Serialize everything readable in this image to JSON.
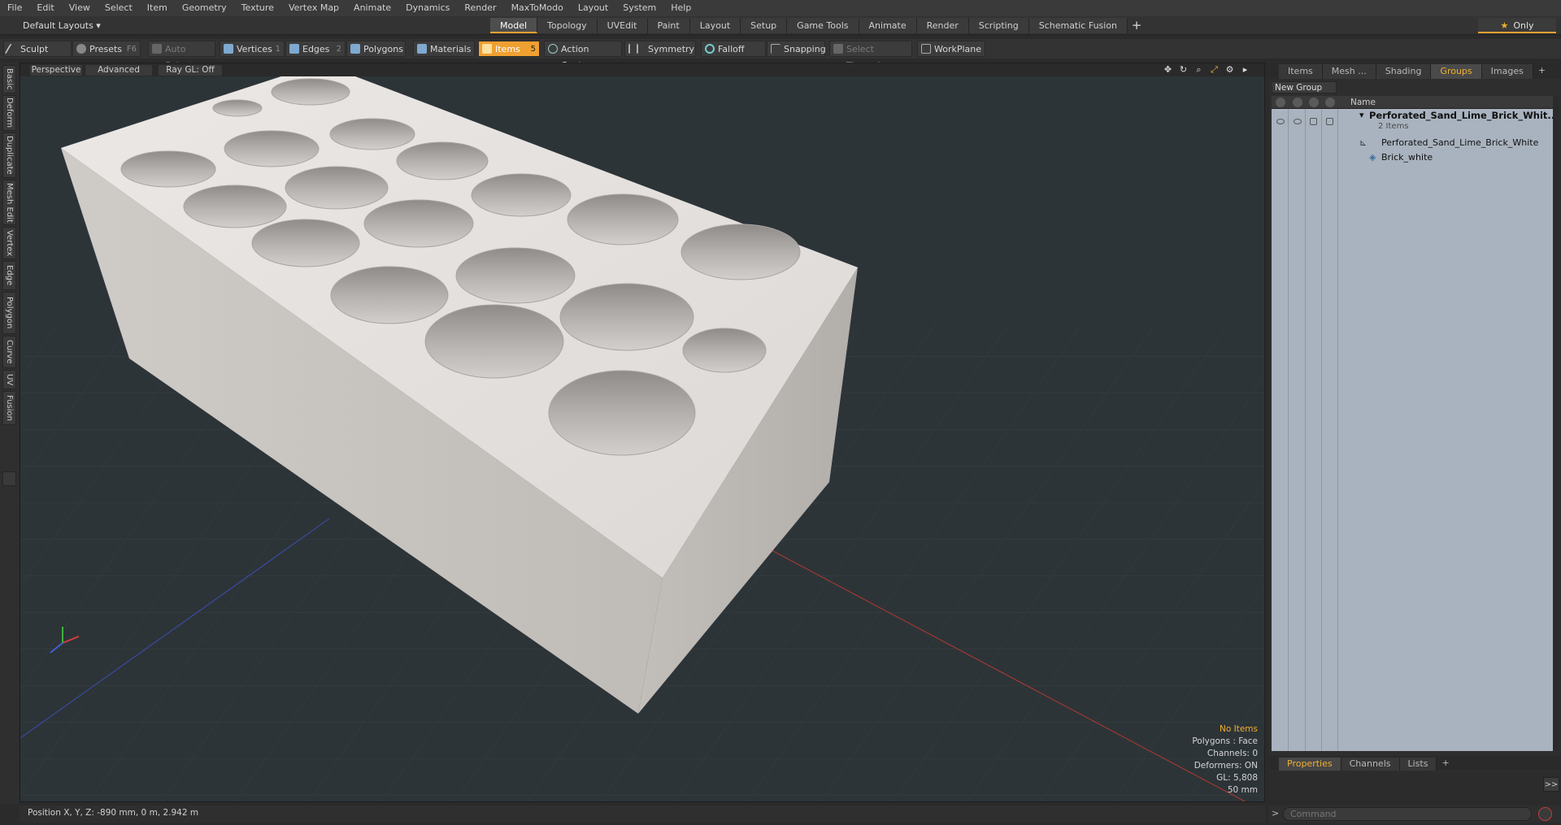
{
  "menu": [
    "File",
    "Edit",
    "View",
    "Select",
    "Item",
    "Geometry",
    "Texture",
    "Vertex Map",
    "Animate",
    "Dynamics",
    "Render",
    "MaxToModo",
    "Layout",
    "System",
    "Help"
  ],
  "layout_selector": "Default Layouts ▾",
  "layout_tabs": [
    "Model",
    "Topology",
    "UVEdit",
    "Paint",
    "Layout",
    "Setup",
    "Game Tools",
    "Animate",
    "Render",
    "Scripting",
    "Schematic Fusion"
  ],
  "layout_tab_plus": "+",
  "only_label": "Only",
  "toolbar": {
    "sculpt": "Sculpt",
    "presets": "Presets",
    "presets_key": "F6",
    "auto_select": "Auto Select",
    "vertices": "Vertices",
    "vertices_key": "1",
    "edges": "Edges",
    "edges_key": "2",
    "polygons": "Polygons",
    "materials": "Materials",
    "items": "Items",
    "items_key": "5",
    "action_center": "Action Center",
    "symmetry": "Symmetry",
    "falloff": "Falloff",
    "snapping": "Snapping",
    "select_through": "Select Through",
    "workplane": "WorkPlane"
  },
  "left_tabs": [
    "Basic",
    "Deform",
    "Duplicate",
    "Mesh Edit",
    "Vertex",
    "Edge",
    "Polygon",
    "Curve",
    "UV",
    "Fusion"
  ],
  "viewport": {
    "view_mode": "Perspective",
    "shading": "Advanced",
    "raygl": "Ray GL: Off",
    "info": {
      "selection": "No Items",
      "polygons": "Polygons : Face",
      "channels": "Channels: 0",
      "deformers": "Deformers: ON",
      "gl": "GL: 5,808",
      "grid": "50 mm"
    }
  },
  "right_panel": {
    "tabs": [
      "Items",
      "Mesh ...",
      "Shading",
      "Groups",
      "Images"
    ],
    "active_tab": "Groups",
    "new_group": "New Group",
    "column_name": "Name",
    "group": {
      "name": "Perforated_Sand_Lime_Brick_Whit...",
      "count": "2 Items",
      "children": [
        "Perforated_Sand_Lime_Brick_White",
        "Brick_white"
      ]
    },
    "bottom_tabs": [
      "Properties",
      "Channels",
      "Lists"
    ],
    "expand": ">>"
  },
  "status": {
    "position": "Position X, Y, Z:  -890 mm, 0 m, 2.942 m"
  },
  "command": {
    "placeholder": "Command"
  },
  "colors": {
    "accent": "#f0a030",
    "viewport_bg": "#2d3438",
    "groups_bg": "#a9b3bf"
  }
}
